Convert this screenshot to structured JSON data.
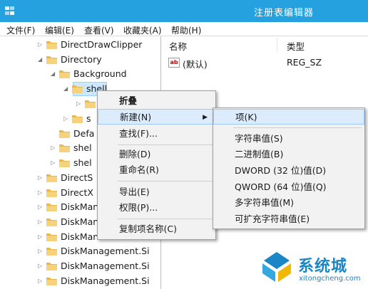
{
  "window": {
    "title": "注册表编辑器"
  },
  "menubar": [
    "文件(F)",
    "编辑(E)",
    "查看(V)",
    "收藏夹(A)",
    "帮助(H)"
  ],
  "tree": {
    "items": [
      "DirectDrawClipper",
      "Directory",
      "Background",
      "shell",
      "",
      "s",
      "Defa",
      "shel",
      "shel",
      "DirectS",
      "DirectX",
      "DiskMan",
      "DiskMan",
      "DiskMan",
      "DiskManagement.Si",
      "DiskManagement.Si",
      "DiskManagement.Si"
    ]
  },
  "list": {
    "columns": {
      "name": "名称",
      "type": "类型"
    },
    "rows": [
      {
        "icon": "string-value-icon",
        "name": "(默认)",
        "type": "REG_SZ"
      }
    ]
  },
  "context_menu": {
    "items": [
      "折叠",
      "新建(N)",
      "查找(F)...",
      "删除(D)",
      "重命名(R)",
      "导出(E)",
      "权限(P)...",
      "复制项名称(C)"
    ]
  },
  "submenu": {
    "items": [
      "项(K)",
      "字符串值(S)",
      "二进制值(B)",
      "DWORD (32 位)值(D)",
      "QWORD (64 位)值(Q)",
      "多字符串值(M)",
      "可扩充字符串值(E)"
    ]
  },
  "watermark": {
    "text": "系统城",
    "url": "xitongcheng.com"
  },
  "colors": {
    "titlebar": "#25a1df",
    "selection": "#cce8ff",
    "highlight": "#dcecfc",
    "folder": "#e8b94a",
    "watermark": "#1a86c6"
  }
}
